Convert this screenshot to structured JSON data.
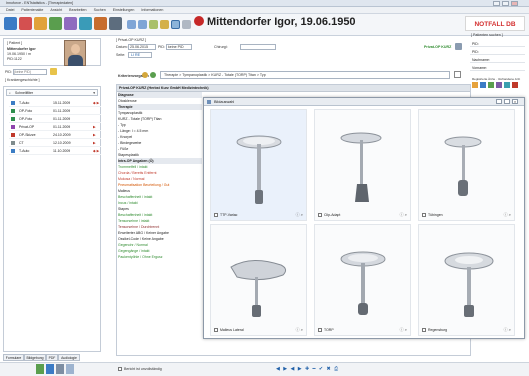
{
  "window": {
    "title": "Innoforce - ENTstatistics - [Therapiedaten]"
  },
  "menu": [
    "Datei",
    "Patientenakte",
    "Ansicht",
    "Bearbeiten",
    "Suchen",
    "Einstellungen",
    "Informationen"
  ],
  "patient": {
    "name_line": "Mittendorfer Igor, 19.06.1950",
    "notfall": "NOTFALL DB",
    "header_label": "[ Patient ]",
    "name": "Mittendorfer Igor",
    "dob": "19.06.1950 / m",
    "id": "PID:1122"
  },
  "left": {
    "pid_label": "PID:",
    "pid_placeholder": "(keine PID)",
    "search_label": "[ Krankengeschichte ]",
    "filter_label": "Schnellfilter",
    "rows": [
      {
        "type": "T-Auto",
        "date": "15.11.2009",
        "mark": "◆ ▶",
        "color": "#3c7dc4"
      },
      {
        "type": "OP-Foto",
        "date": "01.11.2009",
        "mark": "",
        "color": "#2f8f4e"
      },
      {
        "type": "OP-Foto",
        "date": "01.11.2009",
        "mark": "",
        "color": "#2f8f4e"
      },
      {
        "type": "Privat-OP",
        "date": "01.11.2009",
        "mark": "▶",
        "color": "#8e44ad"
      },
      {
        "type": "OP-Skizze",
        "date": "24.10.2009",
        "mark": "▶",
        "color": "#c0392b"
      },
      {
        "type": "CT",
        "date": "12.10.2009",
        "mark": "▶",
        "color": "#7f8c8d"
      },
      {
        "type": "T-Auto",
        "date": "11.10.2009",
        "mark": "◆ ▶",
        "color": "#3c7dc4"
      }
    ],
    "tabs": [
      "Formulare",
      "Bildgebung",
      "PDF",
      "Audiologie"
    ]
  },
  "form": {
    "header": "[ Privat-OP KURZ ]",
    "datum_label": "Datum:",
    "datum": "25.06.2015",
    "pid_label": "PID:",
    "pid": "keine PID",
    "chir_label": "Chirurgi:",
    "seite_label": "Seite:",
    "seite": "LI  RE",
    "privat_badge": "Privat-OP KURZ",
    "kategorie_label": "Kriterienvorgaben",
    "breadcrumb": "Therapie > Tympanoplastik > KURZ - Totale (TORP) Titan > Typ"
  },
  "tree": {
    "title": "Privat-OP KURZ (Herbst Kurz GmbH Medizintechnik)",
    "items": [
      {
        "t": "Diagnose",
        "cls": "section"
      },
      {
        "t": "Otosklerose",
        "cls": ""
      },
      {
        "t": "Therapie",
        "cls": "section"
      },
      {
        "t": "Tympanoplastik",
        "cls": ""
      },
      {
        "t": "   KURZ - Totale (TORP) Titan",
        "cls": ""
      },
      {
        "t": "      -  Typ",
        "cls": ""
      },
      {
        "t": "      -  Länge: l = 4.5 mm",
        "cls": ""
      },
      {
        "t": "      -  Knorpel",
        "cls": ""
      },
      {
        "t": "      -  Bindegewebe",
        "cls": ""
      },
      {
        "t": "      -  Füße",
        "cls": ""
      },
      {
        "t": "Stapesplastik",
        "cls": ""
      },
      {
        "t": "Intra-OP Angaben (Ö)",
        "cls": "section"
      },
      {
        "t": "Trommelfell / intakt",
        "cls": "green"
      },
      {
        "t": "Chorda / Bereits Entfernt",
        "cls": "red"
      },
      {
        "t": "Mukosa / Normal",
        "cls": "red"
      },
      {
        "t": "Pneumatisation Beurteilung / Gut",
        "cls": "orange"
      },
      {
        "t": "Malleus",
        "cls": ""
      },
      {
        "t": "   Beschaffenheit / intakt",
        "cls": "green"
      },
      {
        "t": "Incus / intakt",
        "cls": "green"
      },
      {
        "t": "Stapes",
        "cls": ""
      },
      {
        "t": "   Beschaffenheit / intakt",
        "cls": "green"
      },
      {
        "t": "Tensorsehne / intakt",
        "cls": "green"
      },
      {
        "t": "Tensorsehne / Durchtrennt",
        "cls": "darkred"
      },
      {
        "t": "Erweiterter ABG / Keiner Angabe",
        "cls": ""
      },
      {
        "t": "Ossikel-Code / Keine Angabe",
        "cls": ""
      },
      {
        "t": "Gegenohr / Normal",
        "cls": "green"
      },
      {
        "t": "Gegengänge / intakt",
        "cls": "green"
      },
      {
        "t": "Paukentyöhle / Ohne Ergusz",
        "cls": "green"
      }
    ]
  },
  "gallery": {
    "title": "Bildauswahl",
    "items": [
      {
        "label": "TTP-Variac",
        "selected": true
      },
      {
        "label": "Clip-Adapt",
        "selected": false
      },
      {
        "label": "Tübingen",
        "selected": false
      },
      {
        "label": "Malleus Lateral",
        "selected": false
      },
      {
        "label": "TORP",
        "selected": false
      },
      {
        "label": "Regensburg",
        "selected": false
      }
    ]
  },
  "right": {
    "header": "[ Patienten suchen ]",
    "fields": [
      "PID:",
      "PID:",
      "Nachname:",
      "Vorname:"
    ],
    "footer_label": "Registrierte Ärzte  ·  Vorhandene Arzt"
  },
  "bottom": {
    "checkbox_label": "Bericht ist unvollständig",
    "nav": "◀ ▶  ◀ ▶ ✚ ━ ✔ ✖ ⎙"
  },
  "colors": {
    "accent": "#1f5fa8",
    "green": "#2e8b2e",
    "red": "#c0392b",
    "notfall": "#d32f2f"
  }
}
